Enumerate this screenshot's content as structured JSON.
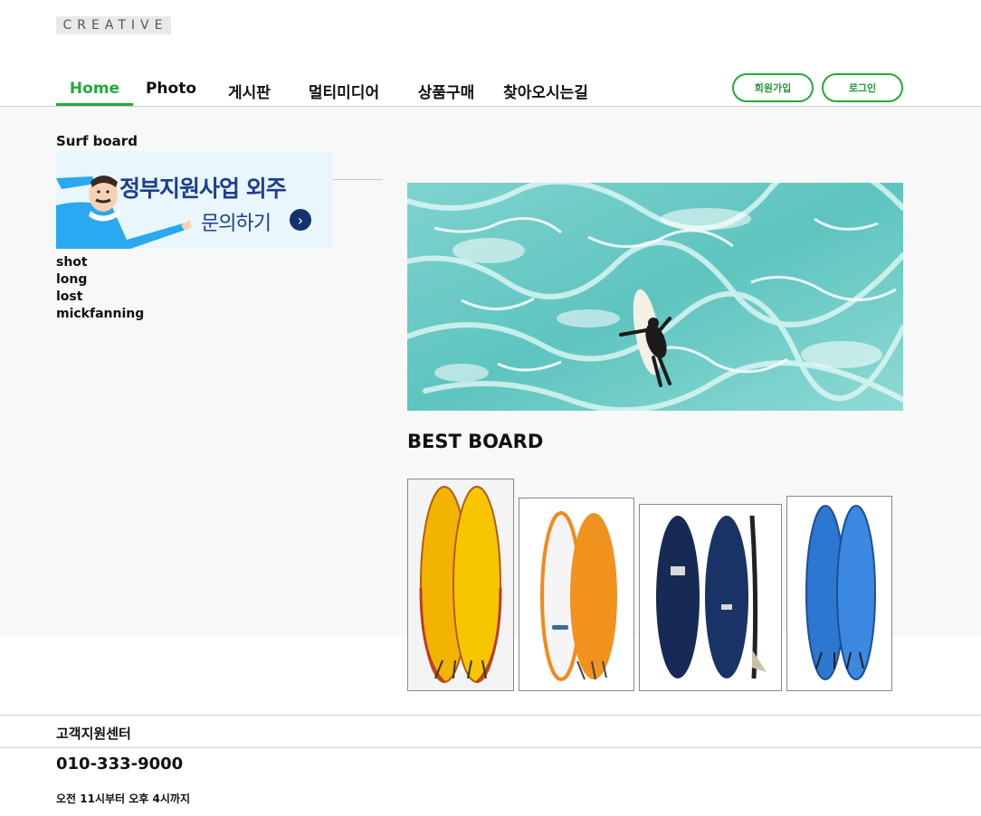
{
  "header": {
    "logo": "CREATIVE",
    "nav": [
      {
        "label": "Home",
        "active": true
      },
      {
        "label": "Photo",
        "active": false
      },
      {
        "label": "게시판",
        "active": false
      },
      {
        "label": "멀티미디어",
        "active": false
      },
      {
        "label": "상품구매",
        "active": false
      },
      {
        "label": "찾아오시는길",
        "active": false
      }
    ],
    "signup": "회원가입",
    "login": "로그인"
  },
  "sidebar": {
    "title": "Surf board",
    "banner": {
      "line1": "정부지원사업 외주",
      "line2": "문의하기"
    },
    "items": [
      "shot",
      "long",
      "lost",
      "mickfanning"
    ]
  },
  "main": {
    "best_title": "BEST BOARD"
  },
  "footer": {
    "title": "고객지원센터",
    "phone": "010-333-9000",
    "hours": "오전 11시부터 오후 4시까지"
  },
  "colors": {
    "accent": "#22aa3c",
    "main_bg": "#f8f8f8"
  }
}
